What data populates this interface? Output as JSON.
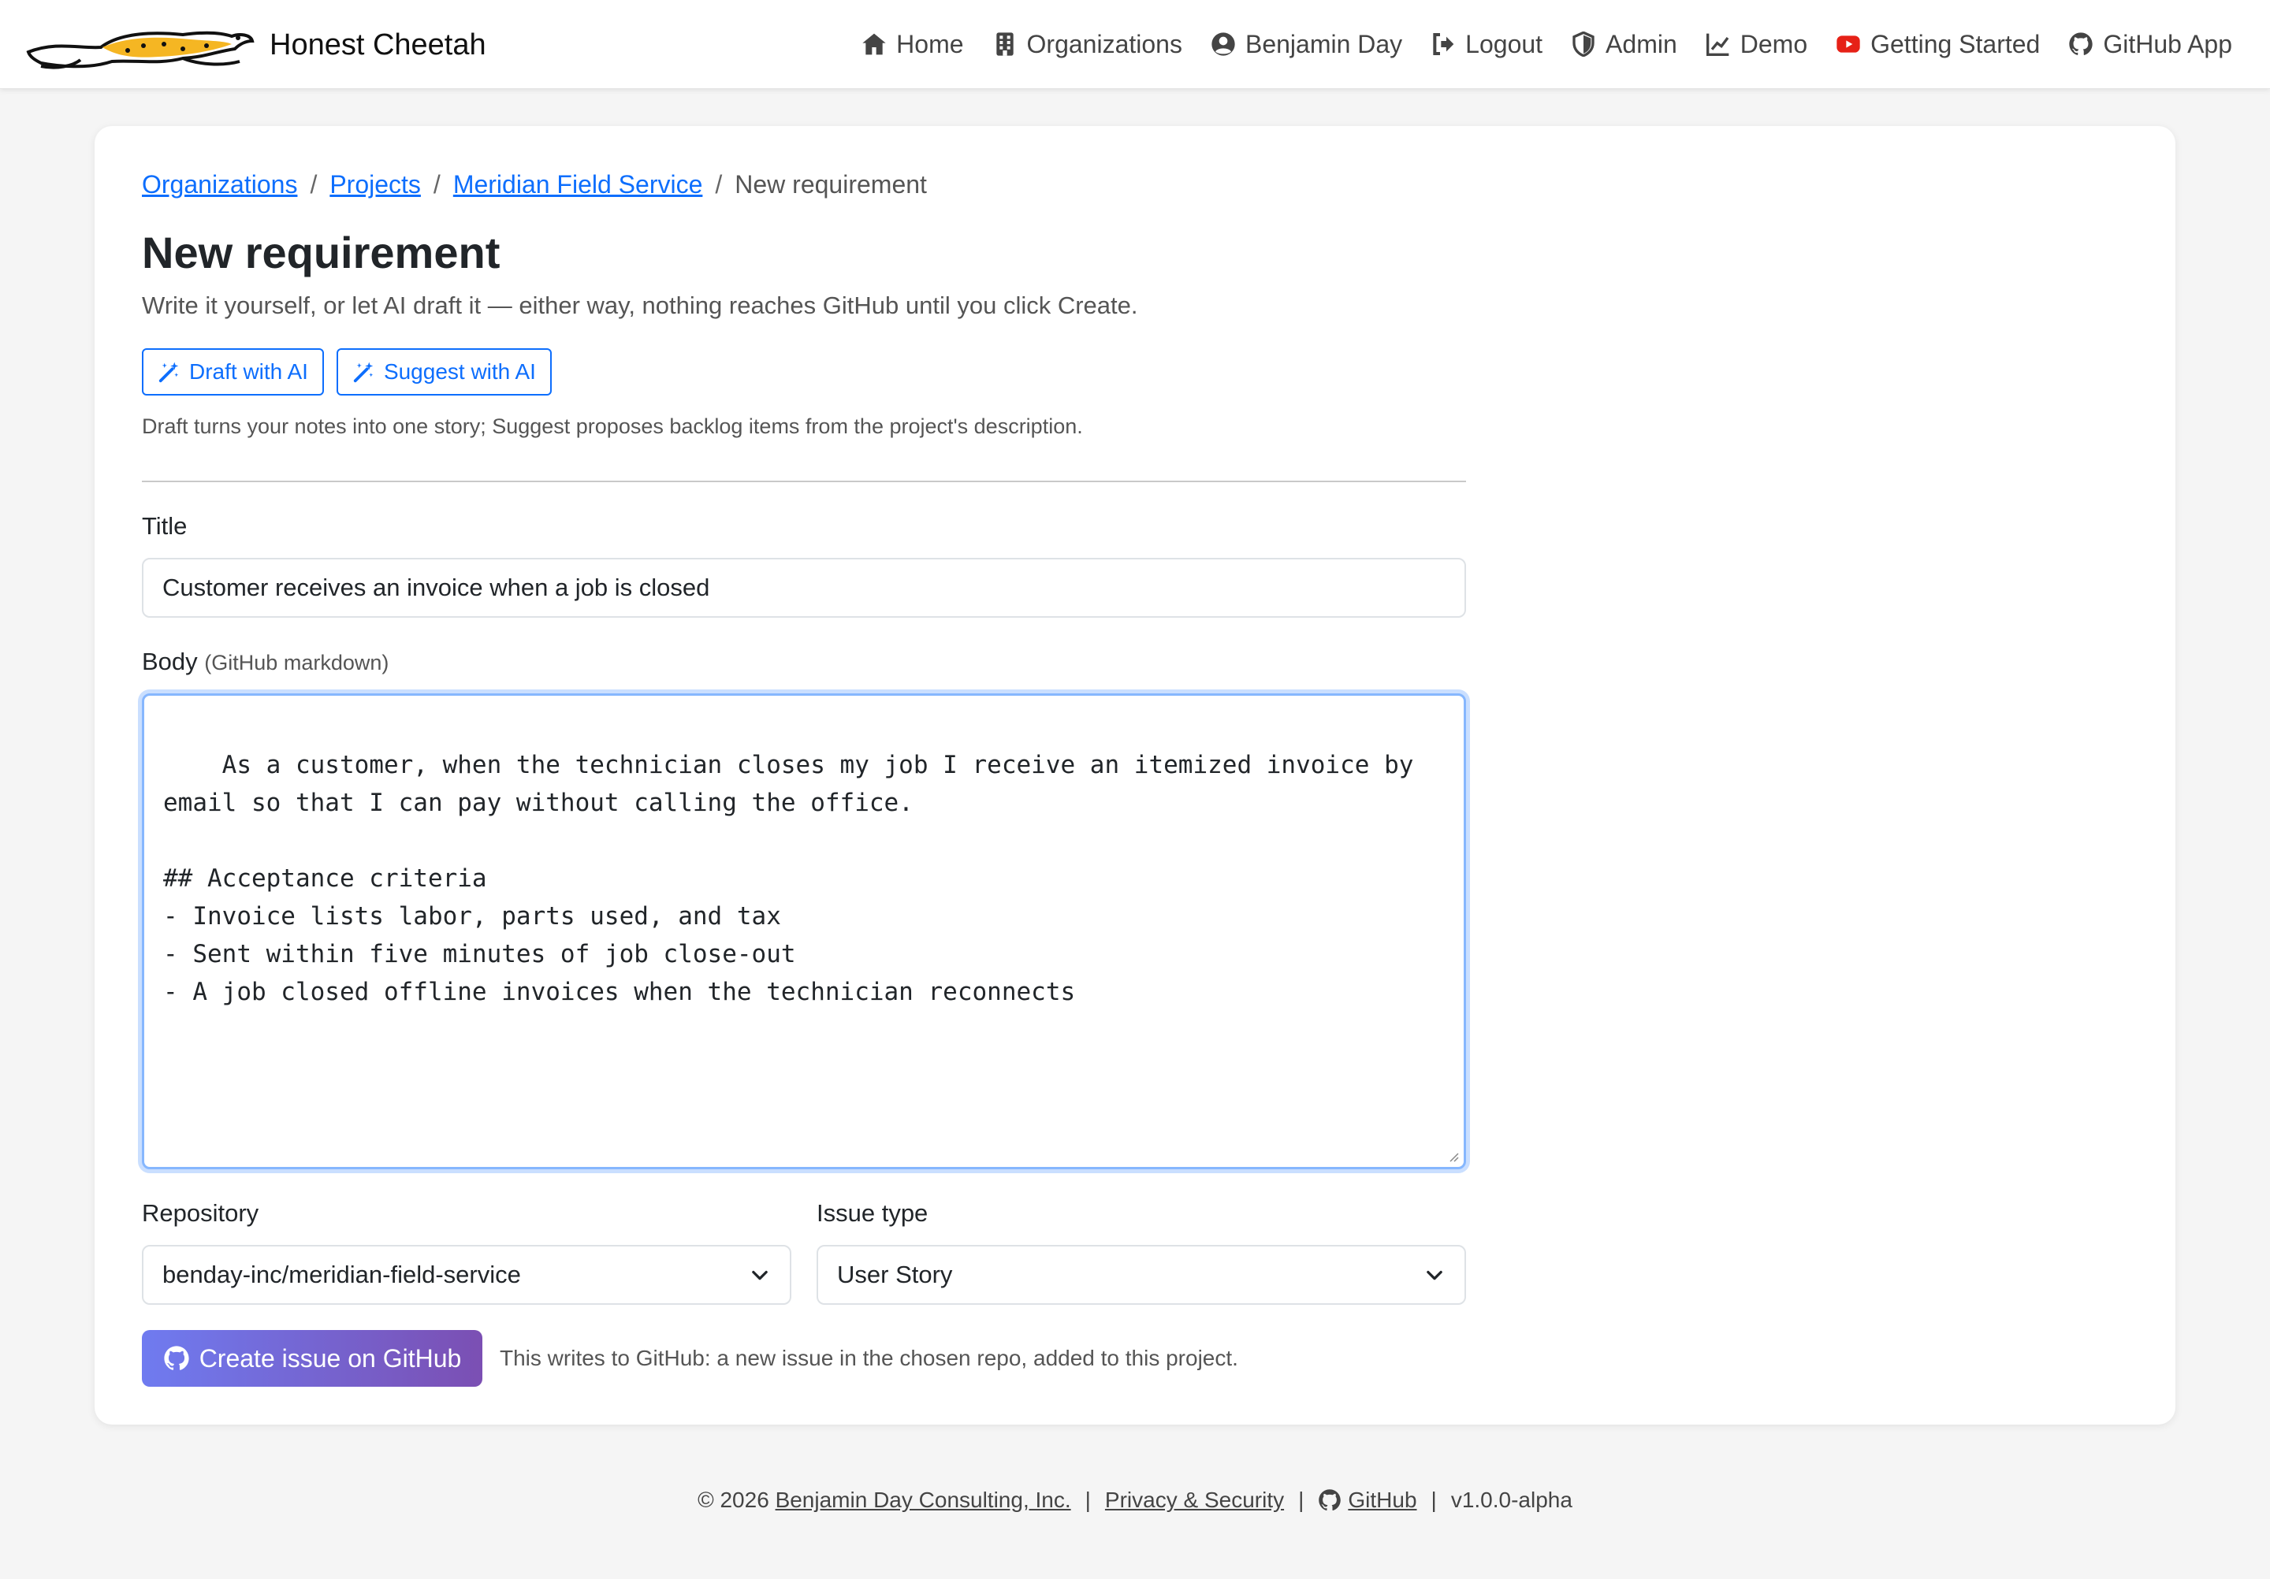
{
  "app": {
    "name": "Honest Cheetah"
  },
  "nav": {
    "home": "Home",
    "organizations": "Organizations",
    "user": "Benjamin Day",
    "logout": "Logout",
    "admin": "Admin",
    "demo": "Demo",
    "getting_started": "Getting Started",
    "github_app": "GitHub App"
  },
  "breadcrumb": {
    "organizations": "Organizations",
    "projects": "Projects",
    "project": "Meridian Field Service",
    "current": "New requirement",
    "separator": "/"
  },
  "page": {
    "title": "New requirement",
    "subtitle": "Write it yourself, or let AI draft it — either way, nothing reaches GitHub until you click Create.",
    "draft_button": "Draft with AI",
    "suggest_button": "Suggest with AI",
    "ai_hint": "Draft turns your notes into one story; Suggest proposes backlog items from the project's description."
  },
  "form": {
    "title_label": "Title",
    "title_value": "Customer receives an invoice when a job is closed",
    "body_label": "Body",
    "body_hint": "(GitHub markdown)",
    "body_value": "As a customer, when the technician closes my job I receive an itemized invoice by\nemail so that I can pay without calling the office.\n\n## Acceptance criteria\n- Invoice lists labor, parts used, and tax\n- Sent within five minutes of job close-out\n- A job closed offline invoices when the technician reconnects",
    "repository_label": "Repository",
    "repository_value": "benday-inc/meridian-field-service",
    "issue_type_label": "Issue type",
    "issue_type_value": "User Story",
    "create_button": "Create issue on GitHub",
    "create_note": "This writes to GitHub: a new issue in the chosen repo, added to this project."
  },
  "footer": {
    "copyright": "© 2026",
    "company": "Benjamin Day Consulting, Inc.",
    "privacy": "Privacy & Security",
    "github": "GitHub",
    "version": "v1.0.0-alpha",
    "separator": "|"
  },
  "colors": {
    "link": "#0d6efd",
    "create_gradient_start": "#6f7bf0",
    "create_gradient_end": "#7b4fb3",
    "youtube_red": "#e62117",
    "focus_border": "#86b7fe"
  },
  "icons": {
    "home": "house-icon",
    "organizations": "building-icon",
    "user": "user-circle-icon",
    "logout": "logout-icon",
    "admin": "shield-icon",
    "demo": "line-chart-icon",
    "getting_started": "youtube-icon",
    "github": "github-icon",
    "ai": "magic-wand-icon",
    "select": "chevron-down-icon"
  }
}
